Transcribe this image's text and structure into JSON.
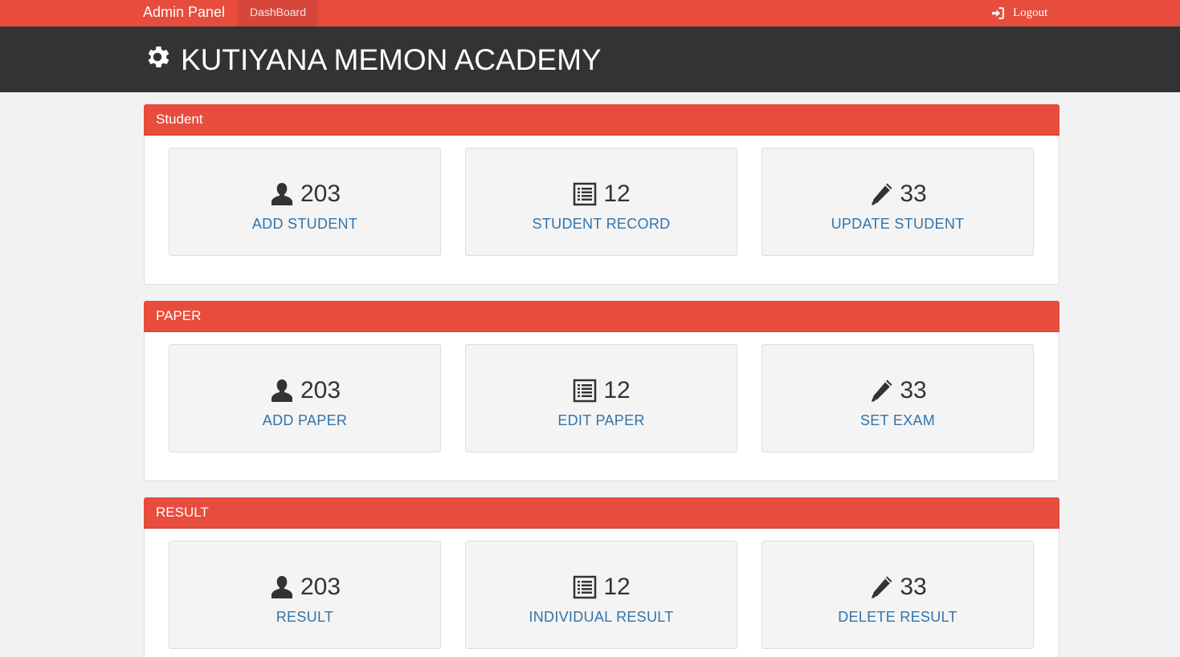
{
  "topnav": {
    "brand": "Admin Panel",
    "tab": "DashBoard",
    "logout": "Logout"
  },
  "header": {
    "title": "KUTIYANA MEMON ACADEMY"
  },
  "colors": {
    "accent": "#e74c3c",
    "header_bg": "#333333",
    "link": "#3174ab"
  },
  "sections": [
    {
      "title": "Student",
      "tiles": [
        {
          "icon": "user-icon",
          "count": "203",
          "label": "ADD STUDENT"
        },
        {
          "icon": "list-icon",
          "count": "12",
          "label": "STUDENT RECORD"
        },
        {
          "icon": "pencil-icon",
          "count": "33",
          "label": "UPDATE STUDENT"
        }
      ]
    },
    {
      "title": "PAPER",
      "tiles": [
        {
          "icon": "user-icon",
          "count": "203",
          "label": "ADD PAPER"
        },
        {
          "icon": "list-icon",
          "count": "12",
          "label": "EDIT PAPER"
        },
        {
          "icon": "pencil-icon",
          "count": "33",
          "label": "SET EXAM"
        }
      ]
    },
    {
      "title": "RESULT",
      "tiles": [
        {
          "icon": "user-icon",
          "count": "203",
          "label": "RESULT"
        },
        {
          "icon": "list-icon",
          "count": "12",
          "label": "INDIVIDUAL RESULT"
        },
        {
          "icon": "pencil-icon",
          "count": "33",
          "label": "DELETE RESULT"
        }
      ]
    }
  ]
}
